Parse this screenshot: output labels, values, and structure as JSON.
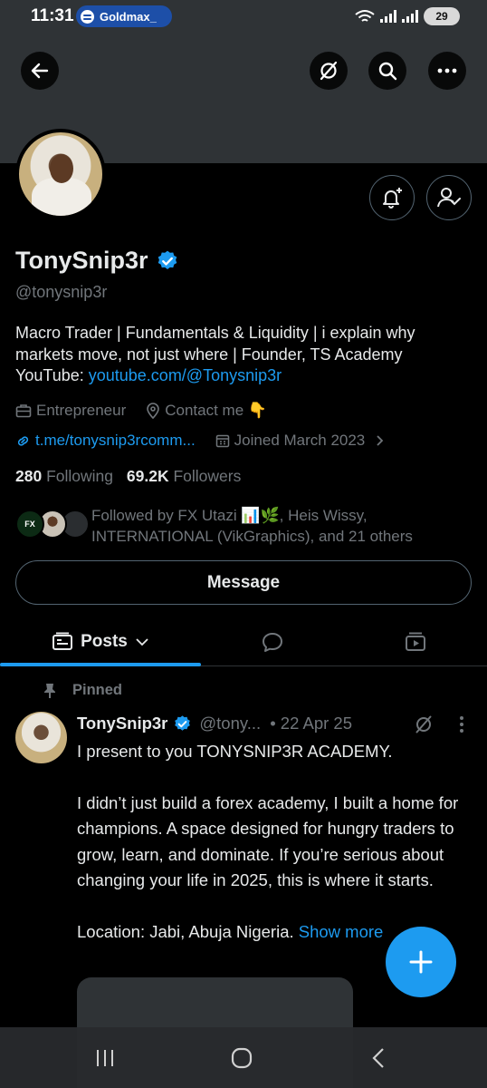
{
  "status_bar": {
    "time": "11:31",
    "app_pill": "Goldmax_",
    "battery": "29"
  },
  "header": {
    "icons": [
      "back-arrow-icon",
      "grok-icon",
      "search-icon",
      "more-icon"
    ]
  },
  "profile": {
    "name": "TonySnip3r",
    "handle": "@tonysnip3r",
    "verified": true,
    "bio_text": "Macro Trader | Fundamentals & Liquidity | i explain why markets move, not just where | Founder, TS Academy YouTube: ",
    "bio_link": "youtube.com/@Tonysnip3r",
    "profession": "Entrepreneur",
    "location": "Contact me 👇",
    "website": "t.me/tonysnip3rcomm...",
    "joined": "Joined March 2023",
    "following_count": "280",
    "following_label": "Following",
    "followers_count": "69.2K",
    "followers_label": "Followers",
    "followed_by": "Followed by FX Utazi 📊🌿, Heis Wissy, INTERNATIONAL (VikGraphics), and 21 others",
    "fx_badge": "FX"
  },
  "actions": {
    "message_label": "Message"
  },
  "tabs": {
    "posts_label": "Posts"
  },
  "pinned_post": {
    "pinned_label": "Pinned",
    "author_name": "TonySnip3r",
    "author_handle": "@tony...",
    "date": "• 22 Apr 25",
    "text": "I present to you TONYSNIP3R ACADEMY.\n\nI didn’t just build a forex academy, I built a home for champions. A space designed for hungry traders to grow, learn, and dominate. If you’re serious about changing your life in 2025, this is where it starts.\n\nLocation: Jabi, Abuja Nigeria. ",
    "show_more": "Show more"
  },
  "colors": {
    "accent": "#1d9bf0",
    "background": "#000000",
    "banner": "#2f3336",
    "muted_text": "#71767b"
  }
}
